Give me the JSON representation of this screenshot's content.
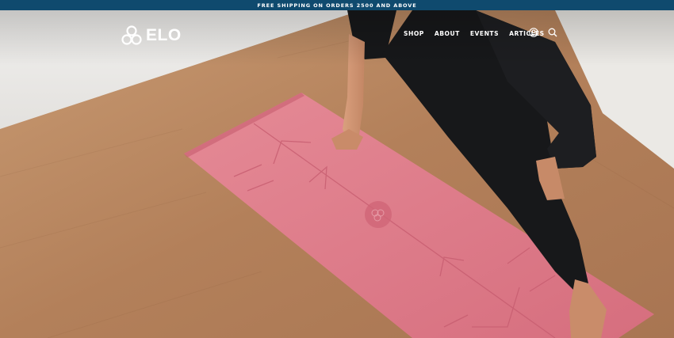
{
  "announcement": {
    "text": "FREE SHIPPING ON ORDERS 2500 AND ABOVE",
    "background": "#0f4a6e"
  },
  "header": {
    "logo_text": "ELO",
    "nav": [
      {
        "label": "SHOP"
      },
      {
        "label": "ABOUT"
      },
      {
        "label": "EVENTS"
      },
      {
        "label": "ARTICLES"
      }
    ],
    "icons": [
      "account-icon",
      "search-icon"
    ]
  },
  "hero": {
    "image": "woman-on-pink-yoga-mat-over-cork-floor",
    "colors": {
      "floor": "#b6845a",
      "mat": "#dd7886",
      "wall": "#e9e7e4",
      "leggings": "#161719"
    }
  }
}
